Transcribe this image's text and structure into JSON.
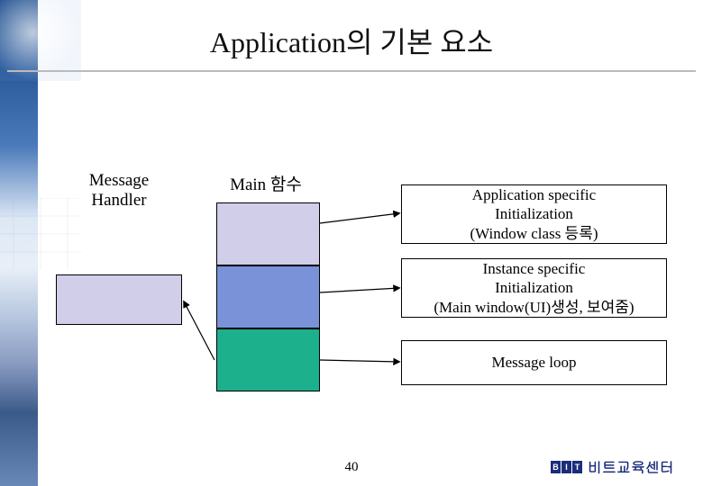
{
  "title": "Application의 기본 요소",
  "labels": {
    "message_handler": "Message\nHandler",
    "main_func": "Main 함수"
  },
  "stages": [
    "Application specific\nInitialization\n(Window class 등록)",
    "Instance specific\nInitialization\n(Main window(UI)생성, 보여줌)",
    "Message loop"
  ],
  "page_number": "40",
  "brand": "비트교육센터",
  "brand_logo": [
    "B",
    "I",
    "T"
  ]
}
